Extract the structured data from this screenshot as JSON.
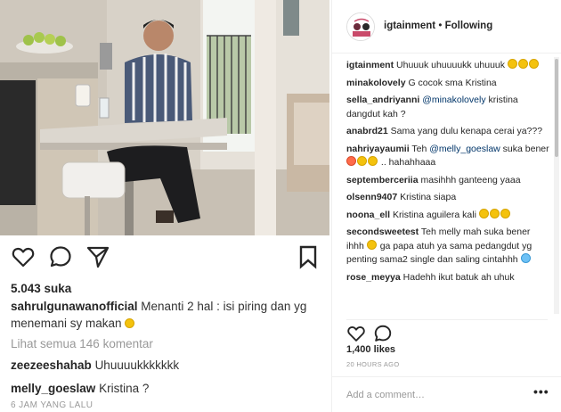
{
  "post": {
    "likes": "5.043 suka",
    "caption_user": "sahrulgunawanofficial",
    "caption_text": "Menanti 2 hal : isi piring dan yg menemani sy makan",
    "view_all": "Lihat semua 146 komentar",
    "comments": [
      {
        "user": "zeezeeshahab",
        "text": "Uhuuuukkkkkkk"
      },
      {
        "user": "melly_goeslaw",
        "text": "Kristina ?"
      }
    ],
    "time": "6 JAM YANG LALU"
  },
  "panel": {
    "account": "igtainment",
    "separator": "•",
    "follow_status": "Following",
    "comments": [
      {
        "user": "igtainment",
        "text": "Uhuuuk uhuuuukk uhuuuk"
      },
      {
        "user": "minakolovely",
        "text": "G cocok sma Kristina"
      },
      {
        "user": "sella_andriyanni",
        "mention": "@minakolovely",
        "text": "kristina dangdut kah ?"
      },
      {
        "user": "anabrd21",
        "text": "Sama yang dulu kenapa cerai ya???"
      },
      {
        "user": "nahriyayaumii",
        "text_before": "Teh",
        "mention": "@melly_goeslaw",
        "text": "suka bener",
        "text_after": ".. hahahhaaa"
      },
      {
        "user": "septemberceriia",
        "text": "masihhh ganteeng yaaa"
      },
      {
        "user": "olsenn9407",
        "text": "Kristina siapa"
      },
      {
        "user": "noona_ell",
        "text": "Kristina aguilera kali"
      },
      {
        "user": "secondsweetest",
        "text": "Teh melly mah suka bener ihhh",
        "text_after": "ga papa atuh ya sama pedangdut yg penting sama2 single dan saling cintahhh"
      },
      {
        "user": "rose_meyya",
        "text": "Hadehh ikut batuk ah uhuk"
      }
    ],
    "likes": "1,400 likes",
    "time": "20 HOURS AGO",
    "add_comment_placeholder": "Add a comment…",
    "more": "•••"
  },
  "icons": {
    "like": "heart-icon",
    "comment": "comment-icon",
    "share": "share-icon",
    "save": "bookmark-icon",
    "options": "more-icon"
  }
}
